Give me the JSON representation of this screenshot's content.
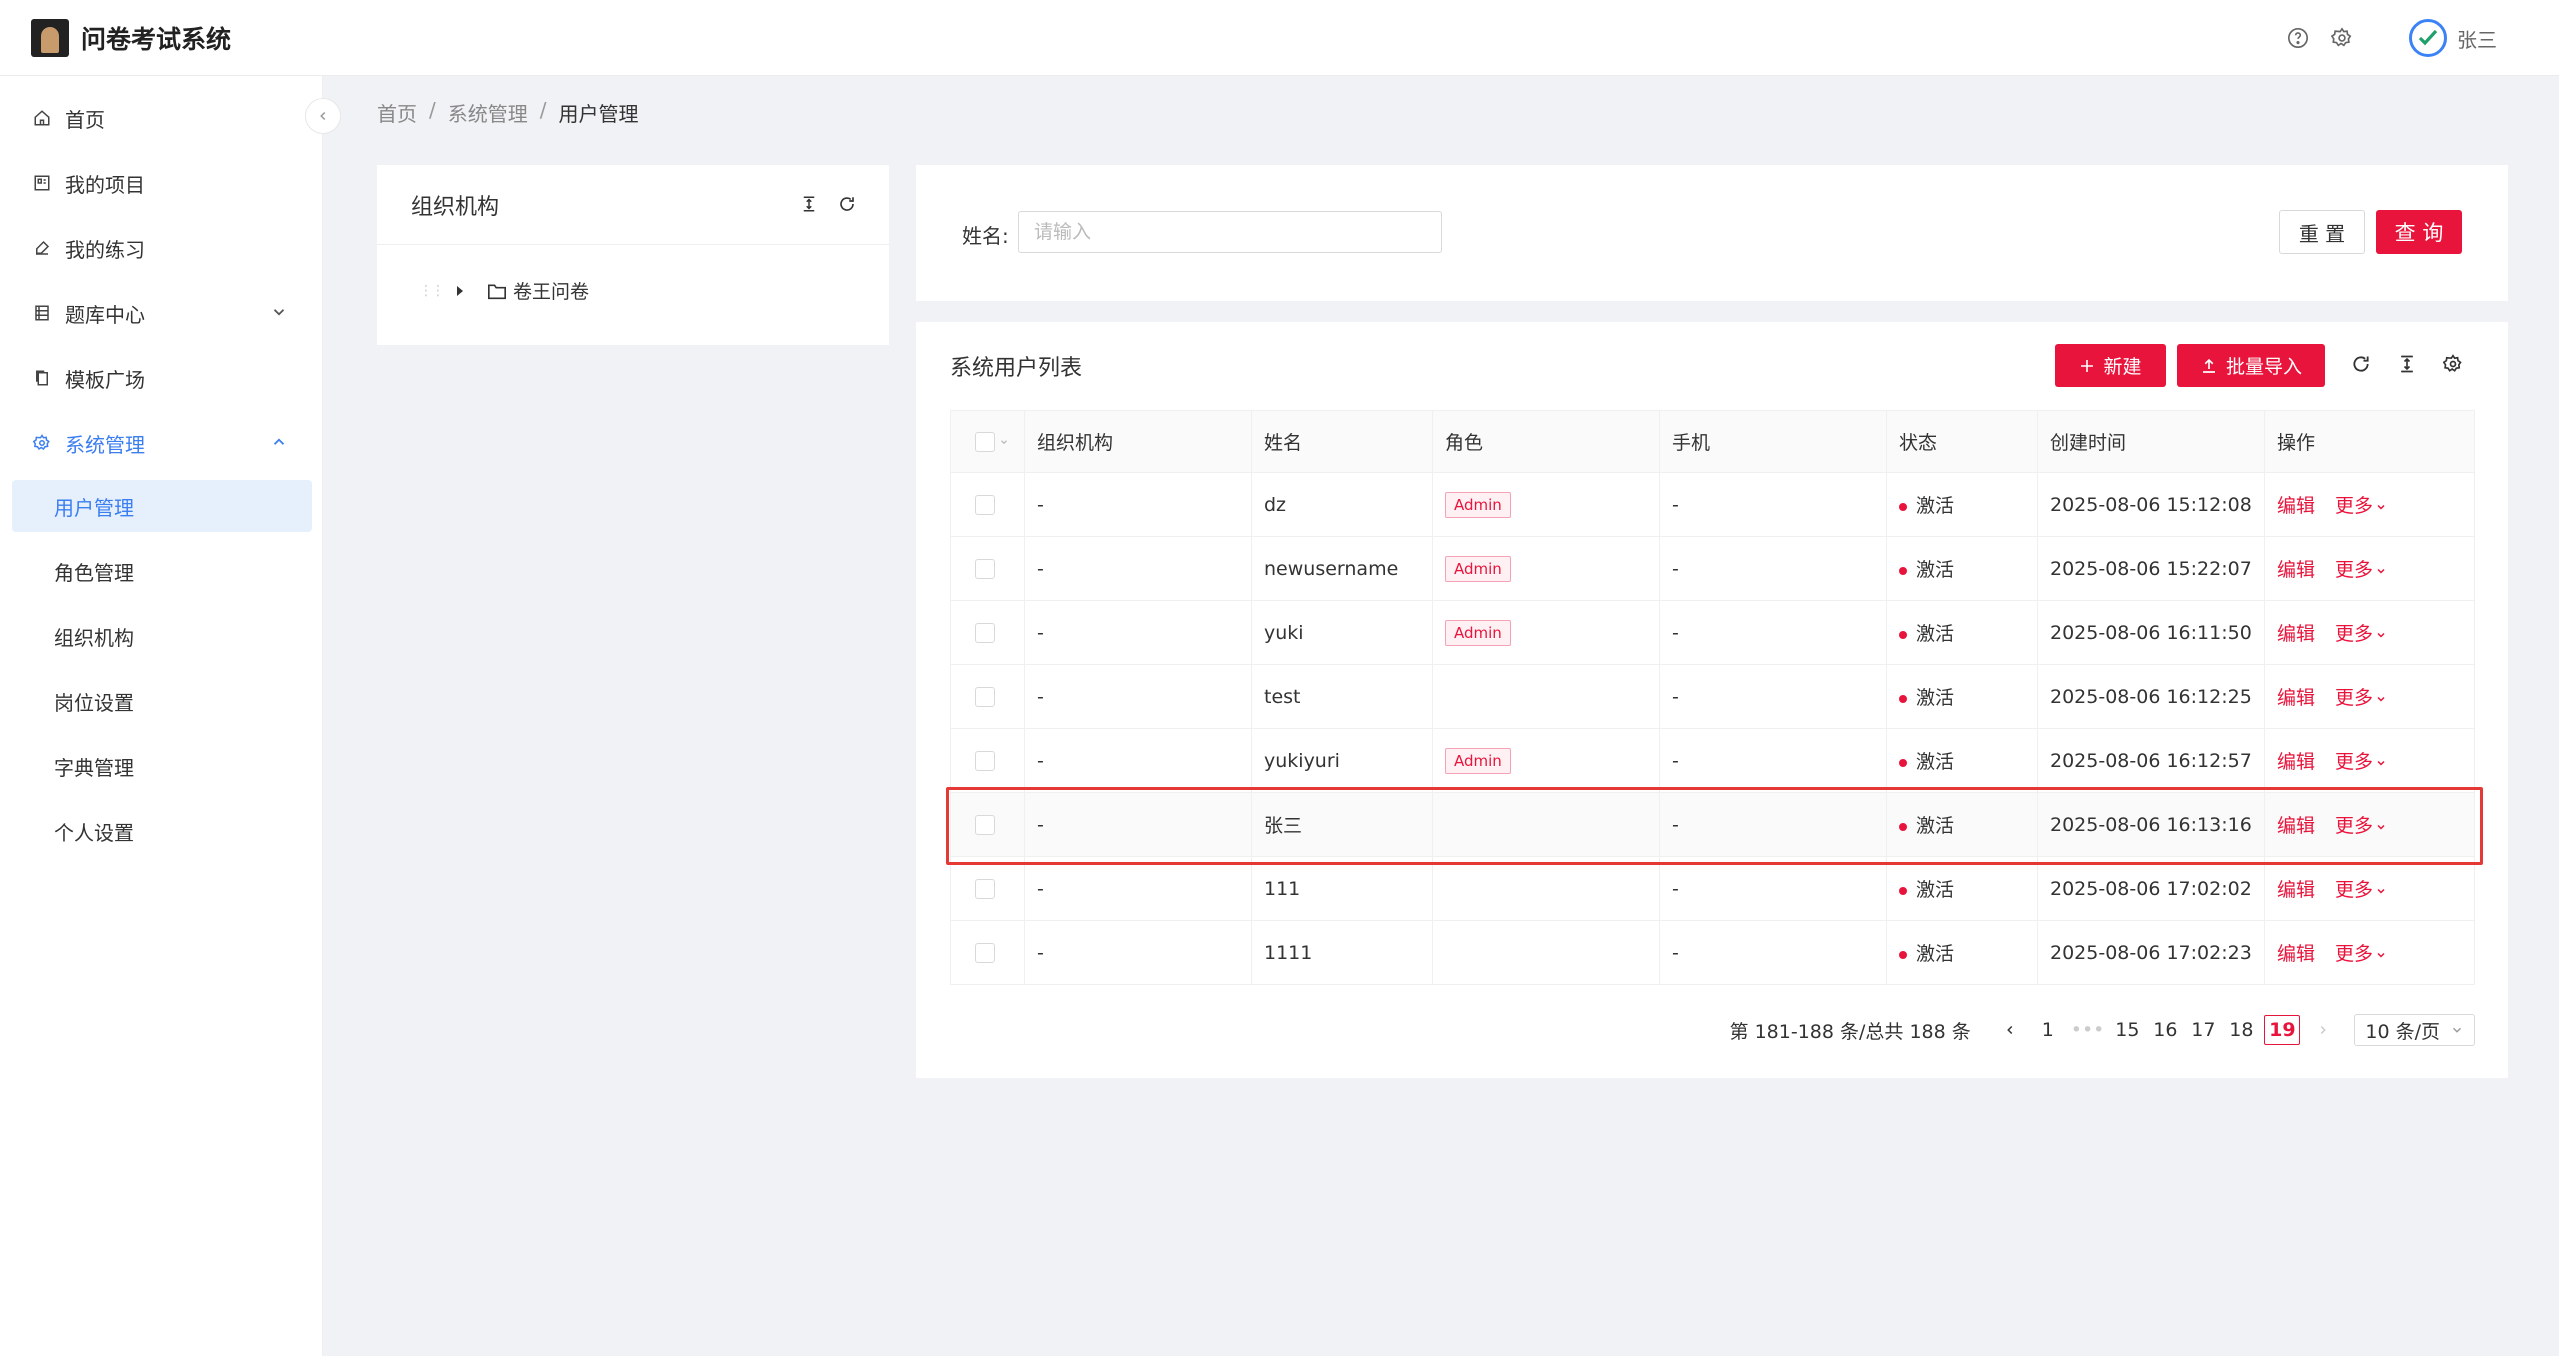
{
  "app": {
    "title": "问卷考试系统",
    "user_name": "张三"
  },
  "sidebar": {
    "items": [
      {
        "label": "首页"
      },
      {
        "label": "我的项目"
      },
      {
        "label": "我的练习"
      },
      {
        "label": "题库中心"
      },
      {
        "label": "模板广场"
      },
      {
        "label": "系统管理"
      }
    ],
    "sub_items": [
      {
        "label": "用户管理"
      },
      {
        "label": "角色管理"
      },
      {
        "label": "组织机构"
      },
      {
        "label": "岗位设置"
      },
      {
        "label": "字典管理"
      },
      {
        "label": "个人设置"
      }
    ]
  },
  "breadcrumb": [
    "首页",
    "系统管理",
    "用户管理"
  ],
  "org_panel": {
    "title": "组织机构",
    "tree": [
      {
        "label": "卷王问卷"
      }
    ]
  },
  "search": {
    "label": "姓名:",
    "placeholder": "请输入",
    "reset_label": "重 置",
    "query_label": "查 询"
  },
  "user_list": {
    "title": "系统用户列表",
    "new_label": "新建",
    "import_label": "批量导入",
    "columns": [
      "组织机构",
      "姓名",
      "角色",
      "手机",
      "状态",
      "创建时间",
      "操作"
    ],
    "edit_label": "编辑",
    "more_label": "更多",
    "rows": [
      {
        "org": "-",
        "name": "dz",
        "role": "Admin",
        "phone": "-",
        "status": "激活",
        "created": "2025-08-06 15:12:08"
      },
      {
        "org": "-",
        "name": "newusername",
        "role": "Admin",
        "phone": "-",
        "status": "激活",
        "created": "2025-08-06 15:22:07"
      },
      {
        "org": "-",
        "name": "yuki",
        "role": "Admin",
        "phone": "-",
        "status": "激活",
        "created": "2025-08-06 16:11:50"
      },
      {
        "org": "-",
        "name": "test",
        "role": "",
        "phone": "-",
        "status": "激活",
        "created": "2025-08-06 16:12:25"
      },
      {
        "org": "-",
        "name": "yukiyuri",
        "role": "Admin",
        "phone": "-",
        "status": "激活",
        "created": "2025-08-06 16:12:57"
      },
      {
        "org": "-",
        "name": "张三",
        "role": "",
        "phone": "-",
        "status": "激活",
        "created": "2025-08-06 16:13:16"
      },
      {
        "org": "-",
        "name": "111",
        "role": "",
        "phone": "-",
        "status": "激活",
        "created": "2025-08-06 17:02:02"
      },
      {
        "org": "-",
        "name": "1111",
        "role": "",
        "phone": "-",
        "status": "激活",
        "created": "2025-08-06 17:02:23"
      }
    ]
  },
  "pagination": {
    "summary": "第 181-188 条/总共 188 条",
    "pages": [
      "1",
      "15",
      "16",
      "17",
      "18",
      "19"
    ],
    "current": "19",
    "page_size": "10 条/页"
  },
  "colors": {
    "accent": "#e8143c",
    "menu_active": "#3b7ef0"
  }
}
